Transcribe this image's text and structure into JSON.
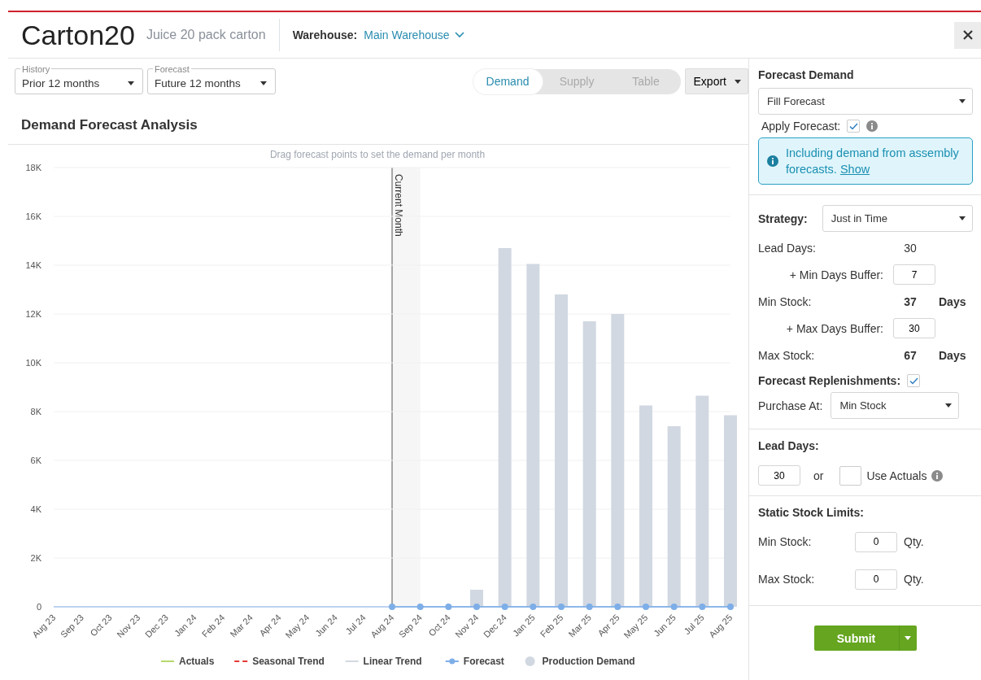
{
  "header": {
    "title": "Carton20",
    "subtitle": "Juice 20 pack carton",
    "warehouse_label": "Warehouse:",
    "warehouse_value": "Main Warehouse"
  },
  "filters": [
    {
      "label": "History",
      "value": "Prior 12 months"
    },
    {
      "label": "Forecast",
      "value": "Future 12 months"
    }
  ],
  "view_tabs": [
    {
      "label": "Demand",
      "selected": true
    },
    {
      "label": "Supply",
      "selected": false
    },
    {
      "label": "Table",
      "selected": false
    }
  ],
  "export_button": "Export",
  "section_title": "Demand Forecast Analysis",
  "chart": {
    "hint": "Drag forecast points to set the demand per month",
    "marker_label": "Current Month",
    "chart_data": {
      "type": "bar",
      "grid": true,
      "categories": [
        "Aug 23",
        "Sep 23",
        "Oct 23",
        "Nov 23",
        "Dec 23",
        "Jan 24",
        "Feb 24",
        "Mar 24",
        "Apr 24",
        "May 24",
        "Jun 24",
        "Jul 24",
        "Aug 24",
        "Sep 24",
        "Oct 24",
        "Nov 24",
        "Dec 24",
        "Jan 25",
        "Feb 25",
        "Mar 25",
        "Apr 25",
        "May 25",
        "Jun 25",
        "Jul 25",
        "Aug 25"
      ],
      "ylim": [
        0,
        18000
      ],
      "yticks": [
        {
          "value": 0,
          "label": "0"
        },
        {
          "value": 2000,
          "label": "2K"
        },
        {
          "value": 4000,
          "label": "4K"
        },
        {
          "value": 6000,
          "label": "6K"
        },
        {
          "value": 8000,
          "label": "8K"
        },
        {
          "value": 10000,
          "label": "10K"
        },
        {
          "value": 12000,
          "label": "12K"
        },
        {
          "value": 14000,
          "label": "14K"
        },
        {
          "value": 16000,
          "label": "16K"
        },
        {
          "value": 18000,
          "label": "18K"
        }
      ],
      "series": [
        {
          "name": "Actuals",
          "color": "#b5d96a",
          "values": [
            null,
            null,
            null,
            null,
            null,
            null,
            null,
            null,
            null,
            null,
            null,
            null,
            null,
            null,
            null,
            null,
            null,
            null,
            null,
            null,
            null,
            null,
            null,
            null,
            null
          ]
        },
        {
          "name": "Seasonal Trend",
          "color": "#e53935",
          "values": [
            null,
            null,
            null,
            null,
            null,
            null,
            null,
            null,
            null,
            null,
            null,
            null,
            null,
            null,
            null,
            null,
            null,
            null,
            null,
            null,
            null,
            null,
            null,
            null,
            null
          ]
        },
        {
          "name": "Linear Trend",
          "color": "#d3d8e0",
          "values": [
            null,
            null,
            null,
            null,
            null,
            null,
            null,
            null,
            null,
            null,
            null,
            null,
            null,
            null,
            null,
            null,
            null,
            null,
            null,
            null,
            null,
            null,
            null,
            null,
            null
          ]
        },
        {
          "name": "Forecast",
          "color": "#7eaee8",
          "values": [
            null,
            null,
            null,
            null,
            null,
            null,
            null,
            null,
            null,
            null,
            null,
            null,
            0,
            0,
            0,
            0,
            0,
            0,
            0,
            0,
            0,
            0,
            0,
            0,
            0
          ]
        },
        {
          "name": "Production Demand",
          "color": "#d1d8e1",
          "values": [
            null,
            null,
            null,
            null,
            null,
            null,
            null,
            null,
            null,
            null,
            null,
            null,
            null,
            null,
            null,
            700,
            14700,
            14050,
            12800,
            11700,
            12000,
            8250,
            7400,
            8650,
            7850
          ]
        }
      ]
    }
  },
  "forecast_demand": {
    "title": "Forecast Demand",
    "select": "Fill Forecast",
    "apply_label": "Apply Forecast:",
    "apply_checked": true,
    "notice": "Including demand from assembly forecasts.",
    "notice_link": "Show"
  },
  "strategy": {
    "label": "Strategy:",
    "value": "Just in Time",
    "rows": [
      {
        "kind": "value",
        "label": "Lead Days:",
        "value": "30"
      },
      {
        "kind": "input",
        "label": "+ Min Days Buffer:",
        "value": "7"
      },
      {
        "kind": "total",
        "label": "Min Stock:",
        "value": "37",
        "unit": "Days"
      },
      {
        "kind": "input",
        "label": "+ Max Days Buffer:",
        "value": "30"
      },
      {
        "kind": "total",
        "label": "Max Stock:",
        "value": "67",
        "unit": "Days"
      }
    ],
    "replenish_label": "Forecast Replenishments:",
    "replenish_checked": true,
    "purchase_label": "Purchase At:",
    "purchase_value": "Min Stock"
  },
  "lead_days": {
    "title": "Lead Days:",
    "value": "30",
    "or": "or",
    "use_actuals_label": "Use Actuals",
    "use_actuals_checked": false
  },
  "static_limits": {
    "title": "Static Stock Limits:",
    "rows": [
      {
        "label": "Min Stock:",
        "value": "0",
        "unit": "Qty."
      },
      {
        "label": "Max Stock:",
        "value": "0",
        "unit": "Qty."
      }
    ]
  },
  "submit_button": "Submit"
}
